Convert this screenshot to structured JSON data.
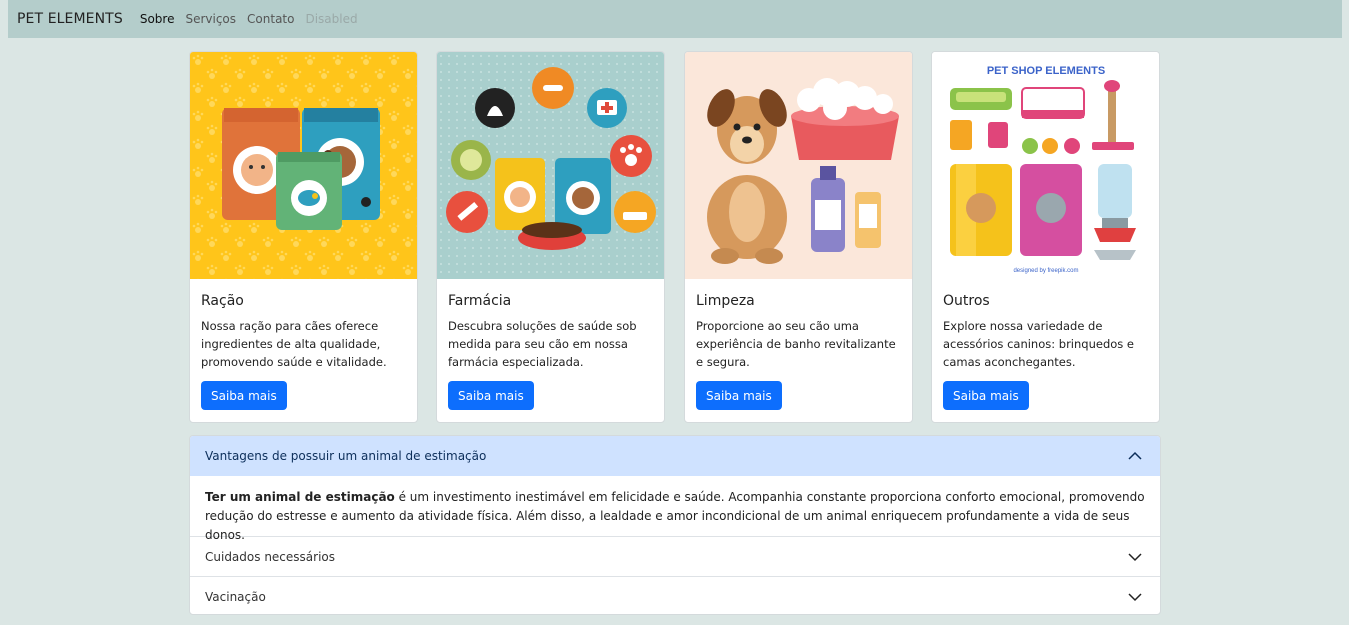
{
  "nav": {
    "brand": "PET ELEMENTS",
    "links": [
      "Sobre",
      "Serviços",
      "Contato",
      "Disabled"
    ]
  },
  "cards": [
    {
      "title": "Ração",
      "text": "Nossa ração para cães oferece ingredientes de alta qualidade, promovendo saúde e vitalidade.",
      "button": "Saiba mais"
    },
    {
      "title": "Farmácia",
      "text": "Descubra soluções de saúde sob medida para seu cão em nossa farmácia especializada.",
      "button": "Saiba mais"
    },
    {
      "title": "Limpeza",
      "text": "Proporcione ao seu cão uma experiência de banho revitalizante e segura.",
      "button": "Saiba mais"
    },
    {
      "title": "Outros",
      "text": "Explore nossa variedade de acessórios caninos: brinquedos e camas aconchegantes.",
      "button": "Saiba mais"
    }
  ],
  "images": {
    "outros_heading": "PET SHOP ELEMENTS",
    "outros_credit": "designed by freepik.com"
  },
  "accordion": {
    "items": [
      {
        "header": "Vantagens de possuir um animal de estimação",
        "body_strong": "Ter um animal de estimação",
        "body_rest": " é um investimento inestimável em felicidade e saúde. Acompanhia constante proporciona conforto emocional, promovendo redução do estresse e aumento da atividade física. Além disso, a lealdade e amor incondicional de um animal enriquecem profundamente a vida de seus donos."
      },
      {
        "header": "Cuidados necessários"
      },
      {
        "header": "Vacinação"
      }
    ]
  },
  "colors": {
    "page_bg": "#dbe6e4",
    "navbar_bg": "#b4cdcb",
    "primary": "#0d6efd",
    "accordion_open_bg": "#cfe2ff"
  }
}
